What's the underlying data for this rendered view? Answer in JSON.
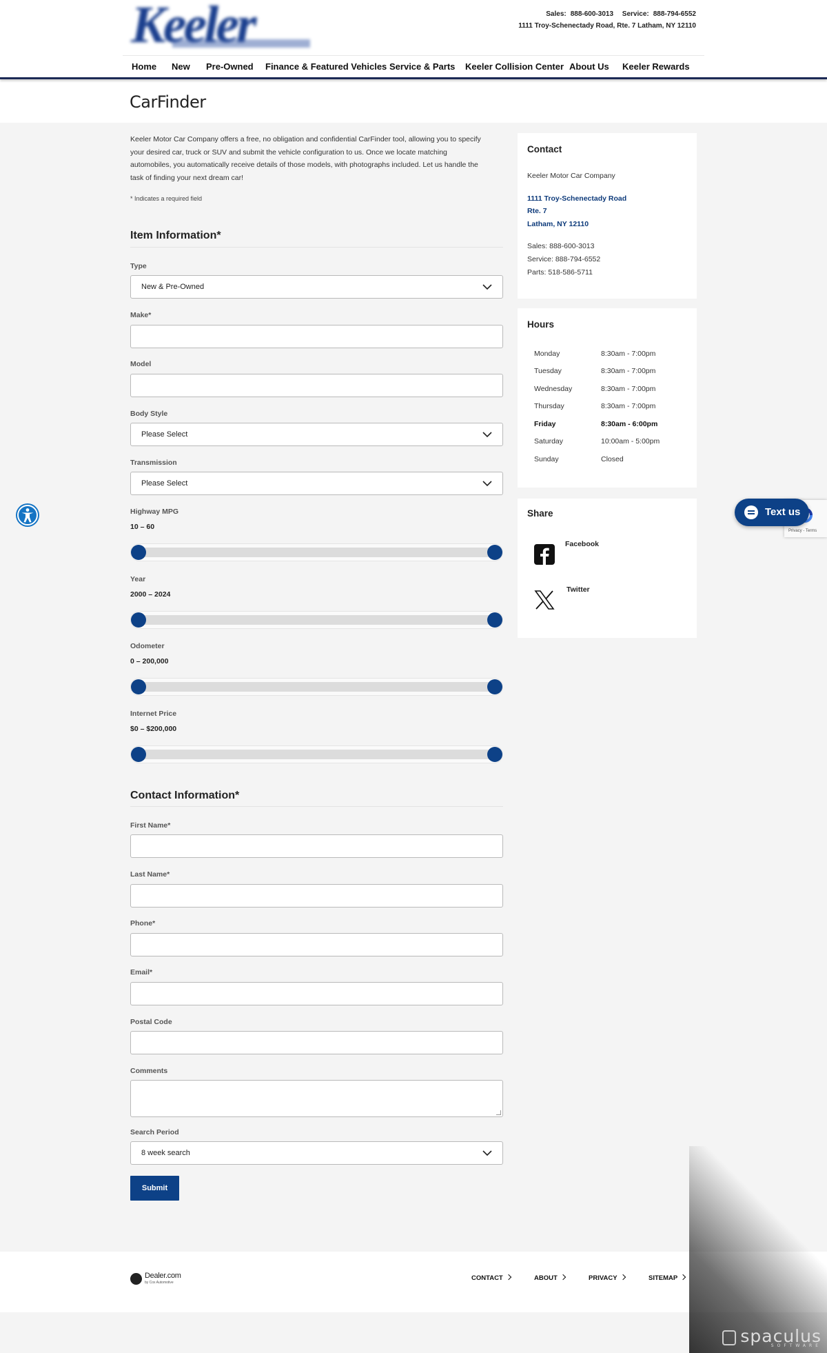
{
  "header": {
    "logo_text": "Keeler",
    "logo_subtext": "MOTOR CAR COMPANY",
    "sales_label": "Sales:",
    "sales_phone": "888-600-3013",
    "service_label": "Service:",
    "service_phone": "888-794-6552",
    "address_line": "1111 Troy-Schenectady Road, Rte. 7 Latham, NY 12110"
  },
  "nav": {
    "items": [
      {
        "label": "Home"
      },
      {
        "label": "New"
      },
      {
        "label": "Pre-Owned"
      },
      {
        "label": "Finance & Featured Vehicles"
      },
      {
        "label": "Service & Parts"
      },
      {
        "label": "Keeler Collision Center"
      },
      {
        "label": "About Us"
      },
      {
        "label": "Keeler Rewards"
      }
    ]
  },
  "page": {
    "title": "CarFinder",
    "intro": "Keeler Motor Car Company offers a free, no obligation and confidential CarFinder tool, allowing you to specify your desired car, truck or SUV and submit the vehicle configuration to us. Once we locate matching automobiles, you automatically receive details of those models, with photographs included. Let us handle the task of finding your next dream car!",
    "required_note": "* Indicates a required field"
  },
  "item_info": {
    "heading": "Item Information*",
    "type_label": "Type",
    "type_value": "New & Pre-Owned",
    "make_label": "Make*",
    "model_label": "Model",
    "body_label": "Body Style",
    "body_value": "Please Select",
    "trans_label": "Transmission",
    "trans_value": "Please Select",
    "mpg": {
      "label": "Highway MPG",
      "display": "10 – 60",
      "min": 10,
      "max": 60,
      "low": 10,
      "high": 60
    },
    "year": {
      "label": "Year",
      "display": "2000 – 2024",
      "min": 2000,
      "max": 2024,
      "low": 2000,
      "high": 2024
    },
    "odometer": {
      "label": "Odometer",
      "display": "0 – 200,000",
      "min": 0,
      "max": 200000,
      "low": 0,
      "high": 200000
    },
    "price": {
      "label": "Internet Price",
      "display": "$0 – $200,000",
      "min": 0,
      "max": 200000,
      "low": 0,
      "high": 200000
    }
  },
  "contact_info": {
    "heading": "Contact Information*",
    "first_label": "First Name*",
    "last_label": "Last Name*",
    "phone_label": "Phone*",
    "email_label": "Email*",
    "postal_label": "Postal Code",
    "comments_label": "Comments",
    "period_label": "Search Period",
    "period_value": "8 week search",
    "submit_label": "Submit"
  },
  "sidebar": {
    "contact": {
      "heading": "Contact",
      "company": "Keeler Motor Car Company",
      "addr1": "1111 Troy-Schenectady Road",
      "addr2": "Rte. 7",
      "addr3": "Latham, NY 12110",
      "sales": "Sales: 888-600-3013",
      "service": "Service: 888-794-6552",
      "parts": "Parts: 518-586-5711"
    },
    "hours": {
      "heading": "Hours",
      "rows": [
        {
          "day": "Monday",
          "time": "8:30am - 7:00pm"
        },
        {
          "day": "Tuesday",
          "time": "8:30am - 7:00pm"
        },
        {
          "day": "Wednesday",
          "time": "8:30am - 7:00pm"
        },
        {
          "day": "Thursday",
          "time": "8:30am - 7:00pm"
        },
        {
          "day": "Friday",
          "time": "8:30am - 6:00pm"
        },
        {
          "day": "Saturday",
          "time": "10:00am - 5:00pm"
        },
        {
          "day": "Sunday",
          "time": "Closed"
        }
      ]
    },
    "share": {
      "heading": "Share",
      "facebook": "Facebook",
      "twitter": "Twitter"
    }
  },
  "widgets": {
    "text_us": "Text us",
    "recaptcha_links": "Privacy - Terms"
  },
  "footer": {
    "brand": "Dealer.com",
    "brand_sub": "by Cox Automotive",
    "links": [
      "CONTACT",
      "ABOUT",
      "PRIVACY",
      "SITEMAP"
    ]
  },
  "watermark": {
    "word": "spaculus",
    "sub": "SOFTWARE"
  },
  "colors": {
    "brand_blue": "#0d4187",
    "nav_rule": "#1c2a55"
  }
}
